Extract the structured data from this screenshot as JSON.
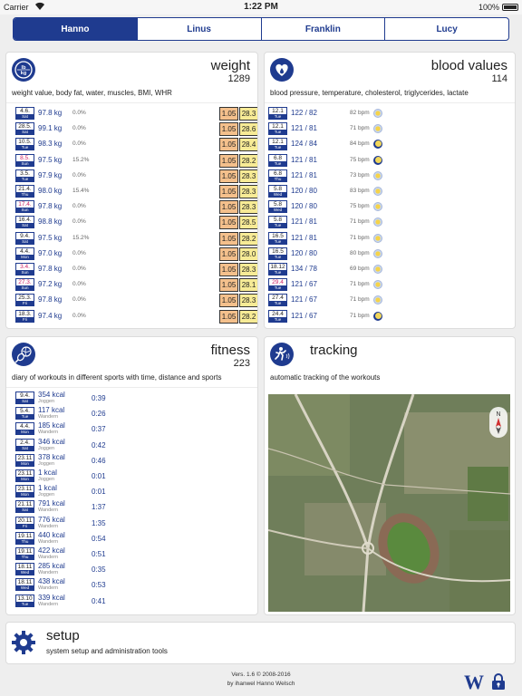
{
  "status": {
    "carrier": "Carrier",
    "time": "1:22 PM",
    "battery": "100%"
  },
  "tabs": [
    {
      "label": "Hanno",
      "active": true
    },
    {
      "label": "Linus",
      "active": false
    },
    {
      "label": "Franklin",
      "active": false
    },
    {
      "label": "Lucy",
      "active": false
    }
  ],
  "weight": {
    "title": "weight",
    "count": "1289",
    "desc": "weight value, body fat, water, muscles, BMI, WHR",
    "icon": "scale-icon",
    "rows": [
      {
        "date": "4.6.",
        "wd": "Sat",
        "kg": "97.8 kg",
        "pct": "0.0%",
        "b1": "1.05",
        "b2": "28.3",
        "pink": false
      },
      {
        "date": "28.5.",
        "wd": "Sat",
        "kg": "99.1 kg",
        "pct": "0.0%",
        "b1": "1.05",
        "b2": "28.6",
        "pink": false
      },
      {
        "date": "10.5.",
        "wd": "Tue",
        "kg": "98.3 kg",
        "pct": "0.0%",
        "b1": "1.05",
        "b2": "28.4",
        "pink": false
      },
      {
        "date": "8.5.",
        "wd": "Sun",
        "kg": "97.5 kg",
        "pct": "15.2%",
        "b1": "1.05",
        "b2": "28.2",
        "pink": true
      },
      {
        "date": "3.5.",
        "wd": "Tue",
        "kg": "97.9 kg",
        "pct": "0.0%",
        "b1": "1.05",
        "b2": "28.3",
        "pink": false
      },
      {
        "date": "21.4.",
        "wd": "Thu",
        "kg": "98.0 kg",
        "pct": "15.4%",
        "b1": "1.05",
        "b2": "28.3",
        "pink": false
      },
      {
        "date": "17.4.",
        "wd": "Sun",
        "kg": "97.8 kg",
        "pct": "0.0%",
        "b1": "1.05",
        "b2": "28.3",
        "pink": true
      },
      {
        "date": "16.4.",
        "wd": "Sat",
        "kg": "98.8 kg",
        "pct": "0.0%",
        "b1": "1.05",
        "b2": "28.5",
        "pink": false
      },
      {
        "date": "9.4.",
        "wd": "Sat",
        "kg": "97.5 kg",
        "pct": "15.2%",
        "b1": "1.05",
        "b2": "28.2",
        "pink": false
      },
      {
        "date": "4.4.",
        "wd": "Mon",
        "kg": "97.0 kg",
        "pct": "0.0%",
        "b1": "1.05",
        "b2": "28.0",
        "pink": false
      },
      {
        "date": "3.4.",
        "wd": "Sun",
        "kg": "97.8 kg",
        "pct": "0.0%",
        "b1": "1.05",
        "b2": "28.3",
        "pink": true
      },
      {
        "date": "27.3.",
        "wd": "Sun",
        "kg": "97.2 kg",
        "pct": "0.0%",
        "b1": "1.05",
        "b2": "28.1",
        "pink": true
      },
      {
        "date": "25.3.",
        "wd": "Fri",
        "kg": "97.8 kg",
        "pct": "0.0%",
        "b1": "1.05",
        "b2": "28.3",
        "pink": false
      },
      {
        "date": "18.3.",
        "wd": "Fri",
        "kg": "97.4 kg",
        "pct": "0.0%",
        "b1": "1.05",
        "b2": "28.2",
        "pink": false
      }
    ]
  },
  "blood": {
    "title": "blood values",
    "count": "114",
    "desc": "blood pressure, temperature, cholesterol, triglycerides, lactate",
    "icon": "heart-drop-icon",
    "rows": [
      {
        "date": "12.1",
        "wd": "Tue",
        "bp": "122 / 82",
        "bpm": "82 bpm",
        "tod": "sun",
        "pink": false
      },
      {
        "date": "12.1",
        "wd": "Tue",
        "bp": "121 / 81",
        "bpm": "71 bpm",
        "tod": "sun",
        "pink": false
      },
      {
        "date": "12.1",
        "wd": "Tue",
        "bp": "124 / 84",
        "bpm": "84 bpm",
        "tod": "moon",
        "pink": false
      },
      {
        "date": "6.8",
        "wd": "Tue",
        "bp": "121 / 81",
        "bpm": "75 bpm",
        "tod": "moon",
        "pink": false
      },
      {
        "date": "6.8",
        "wd": "Thu",
        "bp": "121 / 81",
        "bpm": "73 bpm",
        "tod": "sun",
        "pink": false
      },
      {
        "date": "5.8",
        "wd": "Wed",
        "bp": "120 / 80",
        "bpm": "83 bpm",
        "tod": "sun",
        "pink": false
      },
      {
        "date": "5.8",
        "wd": "Wed",
        "bp": "120 / 80",
        "bpm": "75 bpm",
        "tod": "sun",
        "pink": false
      },
      {
        "date": "5.8",
        "wd": "Tue",
        "bp": "121 / 81",
        "bpm": "71 bpm",
        "tod": "sun",
        "pink": false
      },
      {
        "date": "16.5",
        "wd": "Tue",
        "bp": "121 / 81",
        "bpm": "71 bpm",
        "tod": "sun",
        "pink": false
      },
      {
        "date": "16.5",
        "wd": "Tue",
        "bp": "120 / 80",
        "bpm": "80 bpm",
        "tod": "sun",
        "pink": false
      },
      {
        "date": "18.12",
        "wd": "Tue",
        "bp": "134 / 78",
        "bpm": "69 bpm",
        "tod": "sun",
        "pink": false
      },
      {
        "date": "29.4",
        "wd": "Tue",
        "bp": "121 / 67",
        "bpm": "71 bpm",
        "tod": "sun",
        "pink": true
      },
      {
        "date": "27.4",
        "wd": "Tue",
        "bp": "121 / 67",
        "bpm": "71 bpm",
        "tod": "sun",
        "pink": false
      },
      {
        "date": "24.4",
        "wd": "Tue",
        "bp": "121 / 67",
        "bpm": "71 bpm",
        "tod": "moon",
        "pink": false
      }
    ]
  },
  "fitness": {
    "title": "fitness",
    "count": "223",
    "desc": "diary of workouts in different sports with time, distance and sports",
    "icon": "sports-icon",
    "rows": [
      {
        "date": "9.4.",
        "wd": "Sat",
        "kcal": "354 kcal",
        "sport": "Joggen",
        "dur": "0:39"
      },
      {
        "date": "5.4.",
        "wd": "Tue",
        "kcal": "117 kcal",
        "sport": "Wandern",
        "dur": "0:26"
      },
      {
        "date": "4.4.",
        "wd": "Mon",
        "kcal": "185 kcal",
        "sport": "Wandern",
        "dur": "0:37"
      },
      {
        "date": "2.4.",
        "wd": "Sat",
        "kcal": "346 kcal",
        "sport": "Joggen",
        "dur": "0:42"
      },
      {
        "date": "23.11",
        "wd": "Mon",
        "kcal": "378 kcal",
        "sport": "Joggen",
        "dur": "0:46"
      },
      {
        "date": "23.11",
        "wd": "Mon",
        "kcal": "1 kcal",
        "sport": "Joggen",
        "dur": "0:01"
      },
      {
        "date": "23.11",
        "wd": "Mon",
        "kcal": "1 kcal",
        "sport": "Joggen",
        "dur": "0:01"
      },
      {
        "date": "21.11",
        "wd": "Sat",
        "kcal": "791 kcal",
        "sport": "Wandern",
        "dur": "1:37"
      },
      {
        "date": "20.11",
        "wd": "Fri",
        "kcal": "776 kcal",
        "sport": "Wandern",
        "dur": "1:35"
      },
      {
        "date": "19.11",
        "wd": "Thu",
        "kcal": "440 kcal",
        "sport": "Wandern",
        "dur": "0:54"
      },
      {
        "date": "19.11",
        "wd": "Thu",
        "kcal": "422 kcal",
        "sport": "Wandern",
        "dur": "0:51"
      },
      {
        "date": "18.11",
        "wd": "Wed",
        "kcal": "285 kcal",
        "sport": "Wandern",
        "dur": "0:35"
      },
      {
        "date": "18.11",
        "wd": "Wed",
        "kcal": "438 kcal",
        "sport": "Wandern",
        "dur": "0:53"
      },
      {
        "date": "13.10",
        "wd": "Tue",
        "kcal": "339 kcal",
        "sport": "Wandern",
        "dur": "0:41"
      }
    ]
  },
  "tracking": {
    "title": "tracking",
    "desc": "automatic tracking of the workouts",
    "icon": "runner-icon",
    "map": "aerial-map"
  },
  "setup": {
    "title": "setup",
    "desc": "system setup and administration tools",
    "icon": "gear-icon"
  },
  "footer": {
    "version": "Vers. 1.6 © 2008-2016",
    "author": "by ihanwel Hanno Welsch",
    "logo": "W"
  },
  "colors": {
    "accent": "#1f3b8f",
    "bmi_orange": "#f4c08c",
    "bmi_yellow": "#f7eb96",
    "pink": "#cc2266"
  }
}
